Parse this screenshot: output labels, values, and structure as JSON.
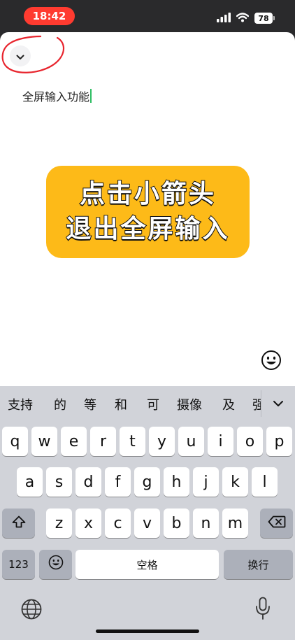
{
  "status_bar": {
    "time": "18:42",
    "battery": "78",
    "icons": [
      "signal-icon",
      "wifi-icon",
      "battery-icon"
    ]
  },
  "sheet": {
    "collapse_icon": "chevron-down-icon",
    "editor_text": "全屏输入功能",
    "callout_line1": "点击小箭头",
    "callout_line2": "退出全屏输入",
    "callout_color": "#fdba18",
    "emoji_icon": "smiley-icon"
  },
  "keyboard": {
    "candidates": [
      "支持",
      "的",
      "等",
      "和",
      "可",
      "摄像",
      "及",
      "强"
    ],
    "row1": [
      "q",
      "w",
      "e",
      "r",
      "t",
      "y",
      "u",
      "i",
      "o",
      "p"
    ],
    "row2": [
      "a",
      "s",
      "d",
      "f",
      "g",
      "h",
      "j",
      "k",
      "l"
    ],
    "row3": [
      "z",
      "x",
      "c",
      "v",
      "b",
      "n",
      "m"
    ],
    "numbers_label": "123",
    "space_label": "空格",
    "return_label": "换行",
    "shift_icon": "shift-icon",
    "delete_icon": "delete-icon",
    "globe_icon": "globe-icon",
    "mic_icon": "microphone-icon"
  }
}
